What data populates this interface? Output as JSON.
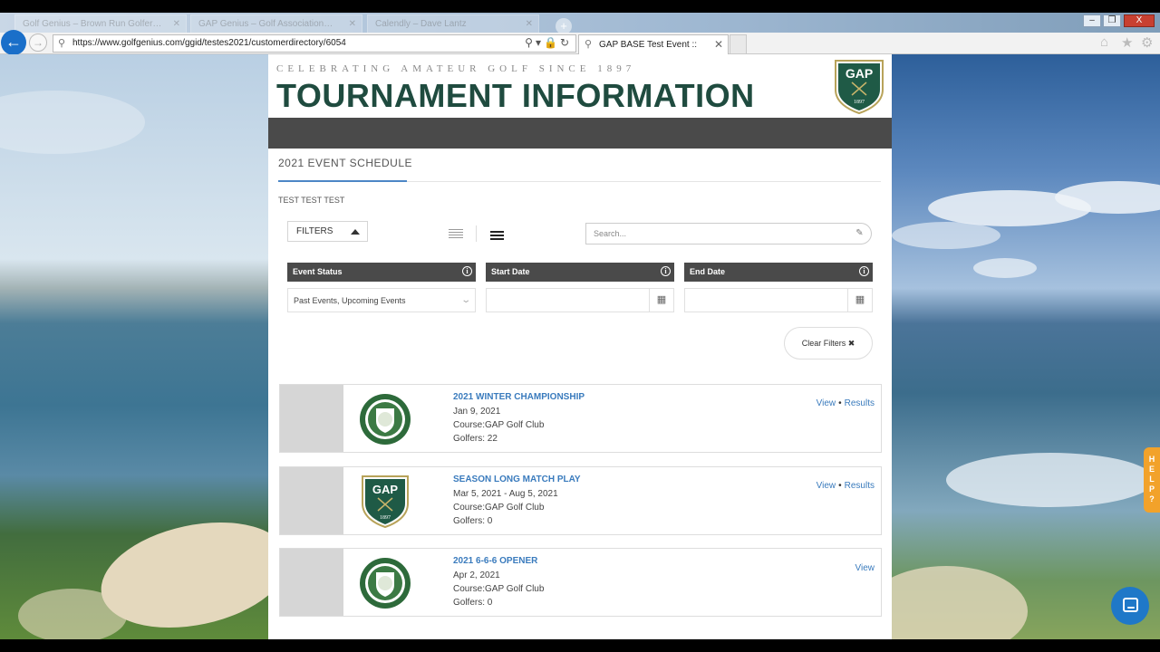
{
  "browser": {
    "background_tabs": [
      "Golf Genius – Brown Run Golfer…",
      "GAP Genius – Golf Association…",
      "Calendly – Dave Lantz"
    ],
    "url": "https://www.golfgenius.com/ggid/testes2021/customerdirectory/6054",
    "active_tab_title": "GAP BASE Test Event ::",
    "back_icon": "back-arrow-icon",
    "forward_icon": "forward-arrow-icon",
    "window_controls": {
      "minimize": "–",
      "restore": "❐",
      "close": "X"
    }
  },
  "header": {
    "tagline": "CELEBRATING AMATEUR GOLF SINCE 1897",
    "title": "TOURNAMENT INFORMATION",
    "logo_text": "GAP",
    "logo_year": "1897"
  },
  "schedule": {
    "title": "2021 EVENT SCHEDULE",
    "subtitle": "TEST TEST TEST",
    "filters_label": "FILTERS",
    "search_placeholder": "Search...",
    "filters": [
      {
        "label": "Event Status",
        "value": "Past Events, Upcoming Events"
      },
      {
        "label": "Start Date",
        "value": ""
      },
      {
        "label": "End Date",
        "value": ""
      }
    ],
    "clear_filters_label": "Clear Filters"
  },
  "events": [
    {
      "name": "2021 WINTER CHAMPIONSHIP",
      "date": "Jan 9, 2021",
      "course": "Course:GAP Golf Club",
      "golfers": "Golfers: 22",
      "view": "View",
      "results": "Results",
      "logo": "association-seal"
    },
    {
      "name": "SEASON LONG MATCH PLAY",
      "date": "Mar 5, 2021 - Aug 5, 2021",
      "course": "Course:GAP Golf Club",
      "golfers": "Golfers: 0",
      "view": "View",
      "results": "Results",
      "logo": "gap-shield"
    },
    {
      "name": "2021 6-6-6 OPENER",
      "date": "Apr 2, 2021",
      "course": "Course:GAP Golf Club",
      "golfers": "Golfers: 0",
      "view": "View",
      "results": "",
      "logo": "association-seal"
    }
  ],
  "help_tab": [
    "H",
    "E",
    "L",
    "P",
    "?"
  ],
  "colors": {
    "brand_green": "#1f4b3f",
    "link_blue": "#3a7bbd",
    "dark_band": "#4a4a4a",
    "help_orange": "#f2a22a",
    "chat_blue": "#1f78c8"
  }
}
